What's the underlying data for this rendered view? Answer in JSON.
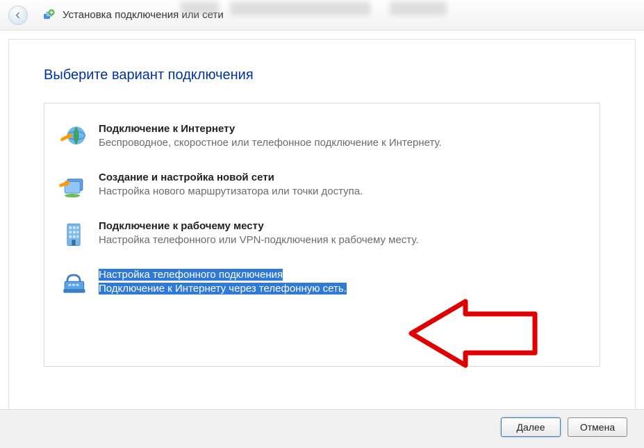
{
  "header": {
    "title": "Установка подключения или сети"
  },
  "dialog": {
    "heading": "Выберите вариант подключения"
  },
  "options": {
    "internet": {
      "title": "Подключение к Интернету",
      "subtitle": "Беспроводное, скоростное или телефонное подключение к Интернету.",
      "icon": "globe-connect-icon"
    },
    "new_network": {
      "title": "Создание и настройка новой сети",
      "subtitle": "Настройка нового маршрутизатора или точки доступа.",
      "icon": "router-setup-icon"
    },
    "workplace": {
      "title": "Подключение к рабочему месту",
      "subtitle": "Настройка телефонного или VPN-подключения к рабочему месту.",
      "icon": "office-building-icon"
    },
    "dialup": {
      "title": "Настройка телефонного подключения",
      "subtitle": "Подключение к Интернету через телефонную сеть.",
      "icon": "phone-modem-icon"
    }
  },
  "buttons": {
    "next_label": "Далее",
    "cancel_label": "Отмена"
  }
}
